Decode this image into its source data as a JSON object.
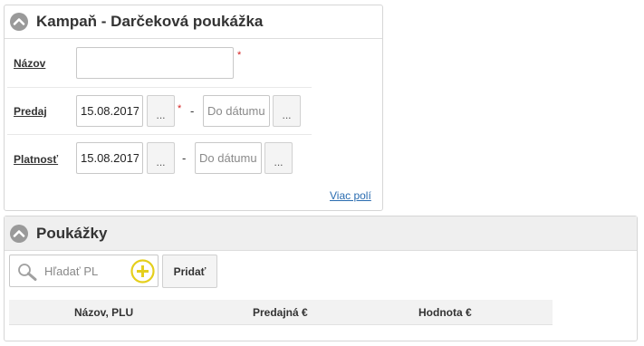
{
  "campaign_panel": {
    "title": "Kampaň - Darčeková poukážka",
    "name_label": "Názov",
    "name_value": "",
    "required_mark": "*",
    "sale_label": "Predaj",
    "sale_from": "15.08.2017",
    "sale_to_placeholder": "Do dátumu",
    "validity_label": "Platnosť",
    "validity_from": "15.08.2017",
    "validity_to_placeholder": "Do dátumu",
    "picker_label": "...",
    "dash": "-",
    "more_fields_link": "Viac polí"
  },
  "vouchers_panel": {
    "title": "Poukážky",
    "search_placeholder": "Hľadať PLU, N",
    "add_button_label": "Pridať",
    "columns": [
      "Názov, PLU",
      "Predajná €",
      "Hodnota €"
    ]
  }
}
